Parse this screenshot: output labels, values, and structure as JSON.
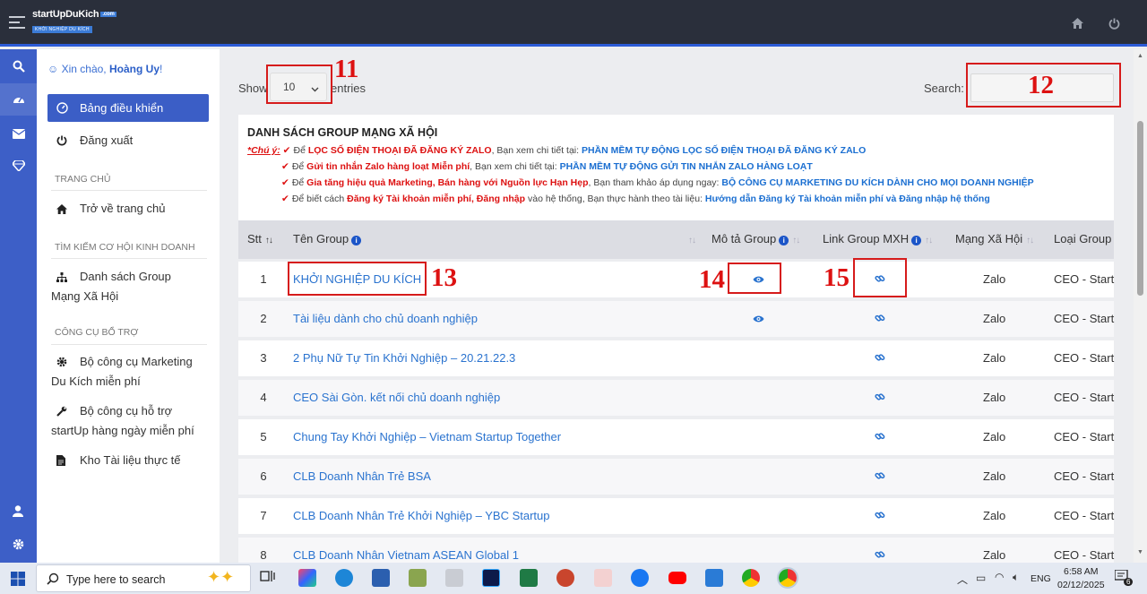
{
  "header": {
    "logo_main": "startUpDuKich",
    "logo_com": ".com",
    "logo_sub": "KHỞI NGHIỆP DU KÍCH"
  },
  "sidebar": {
    "greeting_prefix": "Xin chào, ",
    "user_name": "Hoàng Uy",
    "greeting_suffix": "!",
    "dashboard": "Bảng điều khiển",
    "logout": "Đăng xuất",
    "section_home": "TRANG CHỦ",
    "back_home": "Trở về trang chủ",
    "section_search": "TÌM KIẾM CƠ HỘI KINH DOANH",
    "group_list_1": "Danh sách Group",
    "group_list_2": "Mạng Xã Hội",
    "section_tools": "CÔNG CỤ BỔ TRỢ",
    "tool1_1": "Bộ công cụ Marketing",
    "tool1_2": "Du Kích miễn phí",
    "tool2_1": "Bộ công cụ hỗ trợ",
    "tool2_2": "startUp hàng ngày miễn phí",
    "docs": "Kho Tài liệu thực tế"
  },
  "controls": {
    "show": "Show",
    "entries_value": "10",
    "entries": "entries",
    "search": "Search:"
  },
  "annotations": {
    "a11": "11",
    "a12": "12",
    "a13": "13",
    "a14": "14",
    "a15": "15"
  },
  "notice": {
    "title": "DANH SÁCH GROUP MẠNG XÃ HỘI",
    "chu_y": "*Chú ý:",
    "l1_a": "Để ",
    "l1_b": "LỌC SỐ ĐIỆN THOẠI ĐÃ ĐĂNG KÝ ZALO",
    "l1_c": ", Bạn xem chi tiết tại: ",
    "l1_d": "PHẦN MỀM TỰ ĐỘNG LỌC SỐ ĐIỆN THOẠI ĐÃ ĐĂNG KÝ ZALO",
    "l2_a": "Để ",
    "l2_b": "Gửi tin nhắn Zalo hàng loạt Miễn phí",
    "l2_c": ", Bạn xem chi tiết tại: ",
    "l2_d": "PHẦN MỀM TỰ ĐỘNG GỬI TIN NHẮN ZALO HÀNG LOẠT",
    "l3_a": "Để ",
    "l3_b": "Gia tăng hiệu quả Marketing, Bán hàng với Nguồn lực Hạn Hẹp",
    "l3_c": ", Bạn tham khảo áp dụng ngay: ",
    "l3_d": "BỘ CÔNG CỤ MARKETING DU KÍCH DÀNH CHO MỌI DOANH NGHIỆP",
    "l4_a": "Để biết cách ",
    "l4_b": "Đăng ký Tài khoản miễn phí, Đăng nhập",
    "l4_c": " vào hệ thống, Bạn thực hành theo tài liệu: ",
    "l4_d": "Hướng dẫn Đăng ký Tài khoản miễn phí và Đăng nhập hệ thống"
  },
  "table": {
    "headers": {
      "stt": "Stt",
      "name": "Tên Group",
      "desc": "Mô tả Group",
      "link": "Link Group MXH",
      "network": "Mạng Xã Hội",
      "type": "Loại Group"
    },
    "rows": [
      {
        "stt": "1",
        "name": "KHỞI NGHIỆP DU KÍCH",
        "has_desc": true,
        "network": "Zalo",
        "type": "CEO - Start"
      },
      {
        "stt": "2",
        "name": "Tài liệu dành cho chủ doanh nghiệp",
        "has_desc": true,
        "network": "Zalo",
        "type": "CEO - Start"
      },
      {
        "stt": "3",
        "name": "2 Phụ Nữ Tự Tin Khởi Nghiệp – 20.21.22.3",
        "has_desc": false,
        "network": "Zalo",
        "type": "CEO - Start"
      },
      {
        "stt": "4",
        "name": "CEO Sài Gòn. kết nối chủ doanh nghiệp",
        "has_desc": false,
        "network": "Zalo",
        "type": "CEO - Start"
      },
      {
        "stt": "5",
        "name": "Chung Tay Khởi Nghiệp – Vietnam Startup Together",
        "has_desc": false,
        "network": "Zalo",
        "type": "CEO - Start"
      },
      {
        "stt": "6",
        "name": "CLB Doanh Nhân Trẻ BSA",
        "has_desc": false,
        "network": "Zalo",
        "type": "CEO - Start"
      },
      {
        "stt": "7",
        "name": "CLB Doanh Nhân Trẻ Khởi Nghiệp – YBC Startup",
        "has_desc": false,
        "network": "Zalo",
        "type": "CEO - Start"
      },
      {
        "stt": "8",
        "name": "CLB Doanh Nhân Vietnam ASEAN Global 1",
        "has_desc": false,
        "network": "Zalo",
        "type": "CEO - Start"
      }
    ]
  },
  "taskbar": {
    "search_placeholder": "Type here to search",
    "lang": "ENG",
    "time": "6:58 AM",
    "date": "02/12/2025",
    "notif_count": "6"
  },
  "colors": {
    "topbar": "#2a2f3b",
    "accent": "#3b5ec6",
    "link": "#2a73cf",
    "annotation": "#d61b1b"
  }
}
